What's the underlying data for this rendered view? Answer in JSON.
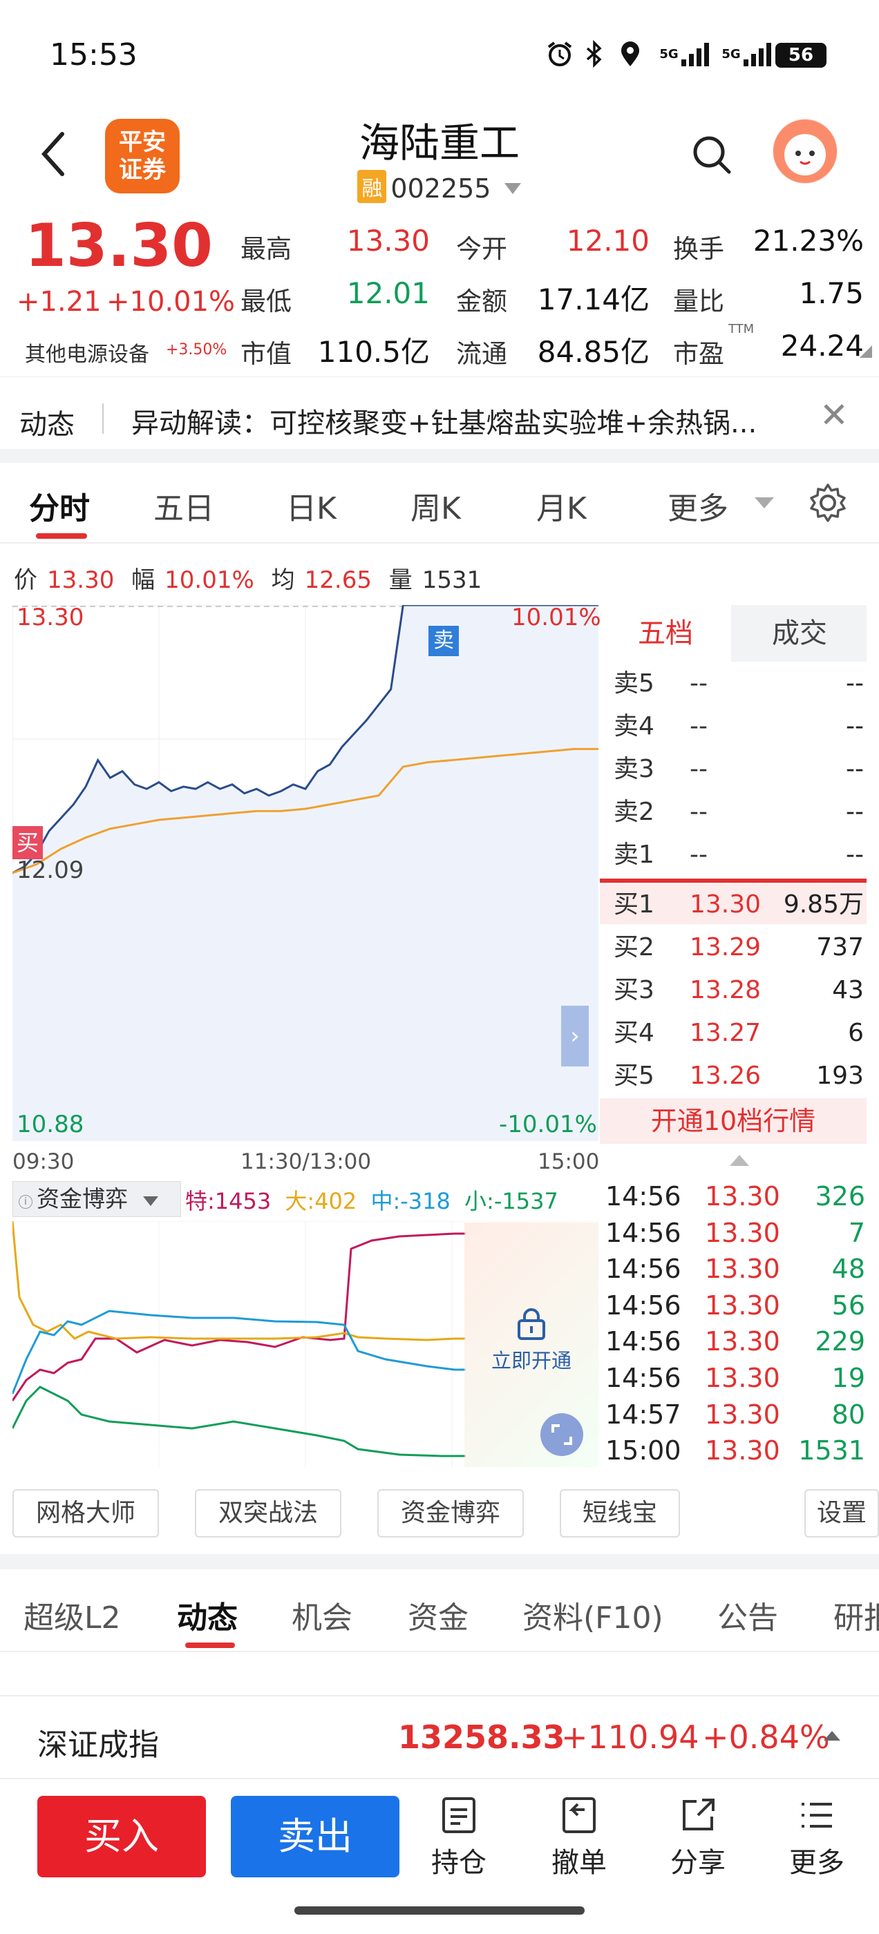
{
  "status": {
    "time": "15:53",
    "battery": "56",
    "net1": "5G",
    "net2": "5G"
  },
  "header": {
    "logo_line1": "平安",
    "logo_line2": "证券",
    "name": "海陆重工",
    "rong": "融",
    "code": "002255"
  },
  "quote": {
    "last": "13.30",
    "change": "+1.21",
    "change_pct": "+10.01%",
    "sector": "其他电源设备",
    "sector_pct": "+3.50%",
    "rows": [
      [
        {
          "l": "最高",
          "v": "13.30",
          "c": "red"
        },
        {
          "l": "今开",
          "v": "12.10",
          "c": "red"
        },
        {
          "l": "换手",
          "v": "21.23%",
          "c": "black"
        }
      ],
      [
        {
          "l": "最低",
          "v": "12.01",
          "c": "green"
        },
        {
          "l": "金额",
          "v": "17.14亿",
          "c": "black"
        },
        {
          "l": "量比",
          "v": "1.75",
          "c": "black"
        }
      ],
      [
        {
          "l": "市值",
          "v": "110.5亿",
          "c": "black"
        },
        {
          "l": "流通",
          "v": "84.85亿",
          "c": "black"
        },
        {
          "l": "市盈",
          "v": "24.24",
          "c": "black",
          "sup": "TTM"
        }
      ]
    ]
  },
  "news": {
    "tab": "动态",
    "text": "异动解读：可控核聚变+钍基熔盐实验堆+余热锅..."
  },
  "chart_tabs": [
    "分时",
    "五日",
    "日K",
    "周K",
    "月K",
    "更多"
  ],
  "info": {
    "price_label": "价",
    "price": "13.30",
    "amp_label": "幅",
    "amp": "10.01%",
    "avg_label": "均",
    "avg": "12.65",
    "vol_label": "量",
    "vol": "1531"
  },
  "chart_labels": {
    "top_price": "13.30",
    "top_pct": "10.01%",
    "prev_close": "12.09",
    "bottom_price": "10.88",
    "bottom_pct": "-10.01%",
    "buy_marker": "买",
    "sell_marker": "卖",
    "t_start": "09:30",
    "t_mid": "11:30/13:00",
    "t_end": "15:00"
  },
  "chart_data": {
    "type": "line",
    "title": "",
    "xlabel": "",
    "ylabel": "",
    "ylim": [
      10.88,
      13.3
    ],
    "prev_close": 12.09,
    "x_ticks": [
      "09:30",
      "11:30/13:00",
      "15:00"
    ],
    "series": [
      {
        "name": "价",
        "color": "#2b4c8c",
        "x": [
          0,
          5,
          10,
          15,
          20,
          25,
          30,
          35,
          40,
          45,
          50,
          55,
          60,
          65,
          70,
          75,
          80,
          85,
          90,
          95,
          100,
          105,
          110,
          115,
          120,
          125,
          130,
          135,
          140,
          145,
          150,
          155,
          160,
          165,
          170,
          175,
          180,
          185,
          190,
          195,
          200,
          205,
          210,
          215,
          220,
          225,
          230,
          235,
          240
        ],
        "values": [
          12.09,
          12.12,
          12.18,
          12.28,
          12.34,
          12.4,
          12.48,
          12.6,
          12.52,
          12.55,
          12.49,
          12.47,
          12.5,
          12.46,
          12.48,
          12.47,
          12.5,
          12.47,
          12.49,
          12.45,
          12.47,
          12.44,
          12.46,
          12.49,
          12.47,
          12.55,
          12.58,
          12.66,
          12.72,
          12.78,
          12.85,
          12.92,
          13.3,
          13.3,
          13.3,
          13.3,
          13.3,
          13.3,
          13.3,
          13.3,
          13.3,
          13.3,
          13.3,
          13.3,
          13.3,
          13.3,
          13.3,
          13.3,
          13.3
        ]
      },
      {
        "name": "均",
        "color": "#f0a030",
        "x": [
          0,
          10,
          20,
          30,
          40,
          50,
          60,
          70,
          80,
          90,
          100,
          110,
          120,
          130,
          140,
          150,
          160,
          170,
          180,
          190,
          200,
          210,
          220,
          230,
          240
        ],
        "values": [
          12.09,
          12.13,
          12.2,
          12.25,
          12.29,
          12.31,
          12.33,
          12.34,
          12.35,
          12.36,
          12.37,
          12.37,
          12.38,
          12.4,
          12.42,
          12.44,
          12.57,
          12.59,
          12.6,
          12.61,
          12.62,
          12.63,
          12.64,
          12.65,
          12.65
        ]
      }
    ]
  },
  "book": {
    "tab1": "五档",
    "tab2": "成交",
    "asks": [
      {
        "l": "卖5",
        "p": "--",
        "v": "--"
      },
      {
        "l": "卖4",
        "p": "--",
        "v": "--"
      },
      {
        "l": "卖3",
        "p": "--",
        "v": "--"
      },
      {
        "l": "卖2",
        "p": "--",
        "v": "--"
      },
      {
        "l": "卖1",
        "p": "--",
        "v": "--"
      }
    ],
    "bids": [
      {
        "l": "买1",
        "p": "13.30",
        "v": "9.85万"
      },
      {
        "l": "买2",
        "p": "13.29",
        "v": "737"
      },
      {
        "l": "买3",
        "p": "13.28",
        "v": "43"
      },
      {
        "l": "买4",
        "p": "13.27",
        "v": "6"
      },
      {
        "l": "买5",
        "p": "13.26",
        "v": "193"
      }
    ],
    "upgrade": "开通10档行情"
  },
  "ticks": [
    {
      "t": "14:56",
      "p": "13.30",
      "v": "326"
    },
    {
      "t": "14:56",
      "p": "13.30",
      "v": "7"
    },
    {
      "t": "14:56",
      "p": "13.30",
      "v": "48"
    },
    {
      "t": "14:56",
      "p": "13.30",
      "v": "56"
    },
    {
      "t": "14:56",
      "p": "13.30",
      "v": "229"
    },
    {
      "t": "14:56",
      "p": "13.30",
      "v": "19"
    },
    {
      "t": "14:57",
      "p": "13.30",
      "v": "80"
    },
    {
      "t": "15:00",
      "p": "13.30",
      "v": "1531"
    }
  ],
  "fund": {
    "title": "资金博弈",
    "te": "特:1453",
    "da": "大:402",
    "zhong": "中:-318",
    "xiao": "小:-1537",
    "unlock": "立即开通"
  },
  "tools": [
    "网格大师",
    "双突战法",
    "资金博弈",
    "短线宝",
    "设置"
  ],
  "bottom_tabs": [
    "超级L2",
    "动态",
    "机会",
    "资金",
    "资料(F10)",
    "公告",
    "研报"
  ],
  "index": {
    "name": "深证成指",
    "value": "13258.33",
    "change": "+110.94",
    "pct": "+0.84%"
  },
  "actions": {
    "buy": "买入",
    "sell": "卖出",
    "hold": "持仓",
    "cancel": "撤单",
    "share": "分享",
    "more": "更多"
  },
  "colors": {
    "up": "#e23030",
    "down": "#0f9d58",
    "accent": "#1a73e8"
  }
}
